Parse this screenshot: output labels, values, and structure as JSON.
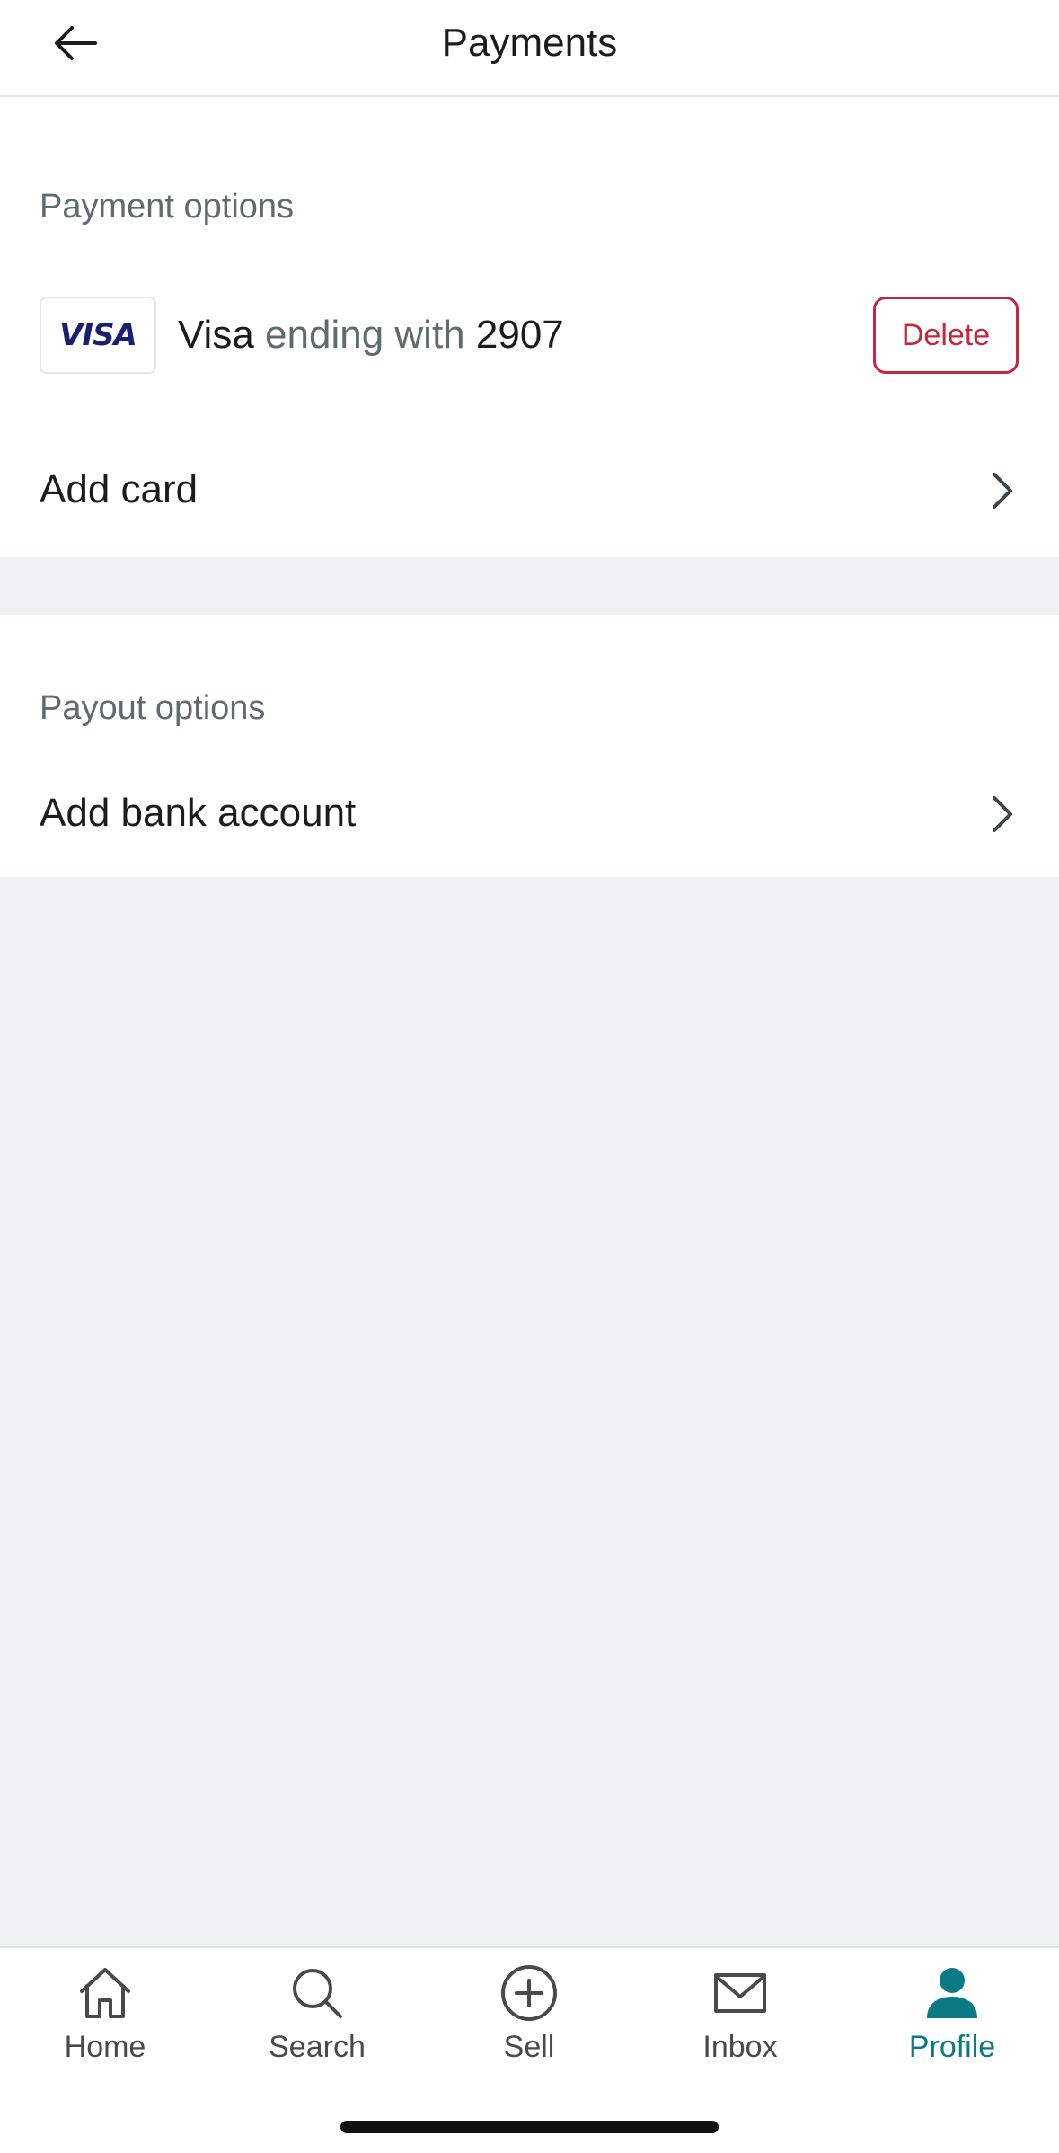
{
  "header": {
    "title": "Payments"
  },
  "payment_options": {
    "label": "Payment options",
    "card": {
      "logo_text": "VISA",
      "brand": "Visa",
      "middle_text": "ending with",
      "last4": "2907",
      "delete_label": "Delete"
    },
    "add_card_label": "Add card"
  },
  "payout_options": {
    "label": "Payout options",
    "add_bank_label": "Add bank account"
  },
  "tabbar": {
    "items": [
      {
        "label": "Home",
        "icon": "home-icon"
      },
      {
        "label": "Search",
        "icon": "search-icon"
      },
      {
        "label": "Sell",
        "icon": "plus-circle-icon"
      },
      {
        "label": "Inbox",
        "icon": "mail-icon"
      },
      {
        "label": "Profile",
        "icon": "person-icon"
      }
    ],
    "active": "Profile"
  },
  "colors": {
    "accent": "#0b7a85",
    "danger": "#c4283f",
    "visa_blue": "#1a1f71",
    "background": "#edf1f2"
  }
}
